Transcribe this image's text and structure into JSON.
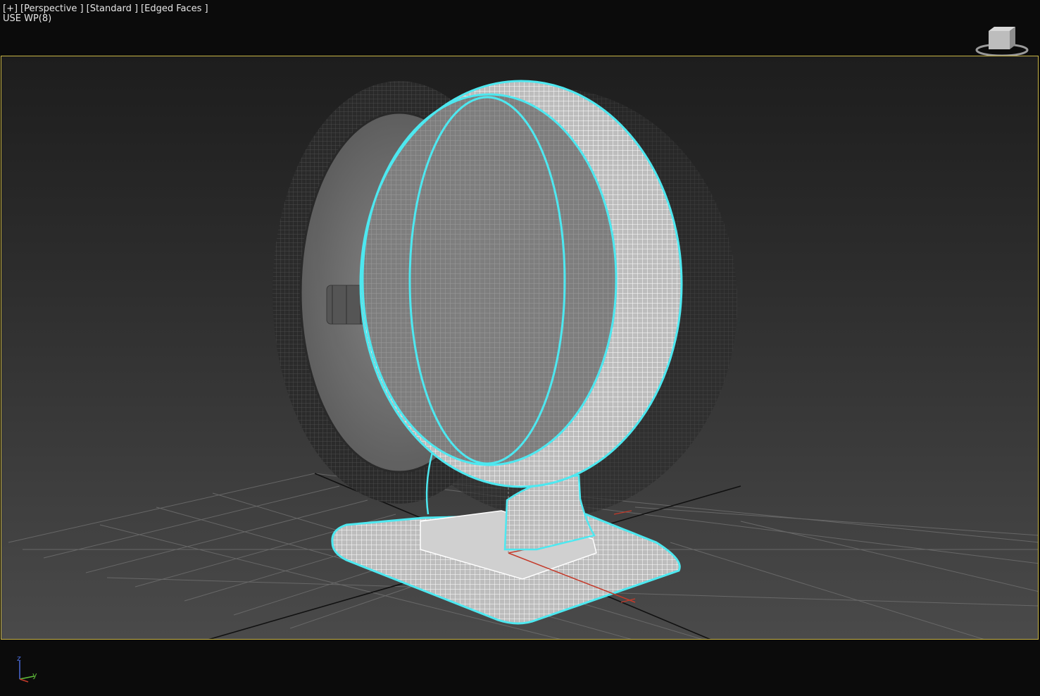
{
  "viewport": {
    "labels": [
      "[+]",
      "[Perspective ]",
      "[Standard ]",
      "[Edged Faces ]"
    ],
    "sub_label": "USE WP(8)",
    "border_color": "#c8b445",
    "selection_color": "#4de8f0"
  },
  "viewcube": {
    "icon": "viewcube-icon"
  },
  "axis_tripod": {
    "z": "z",
    "y": "y"
  }
}
